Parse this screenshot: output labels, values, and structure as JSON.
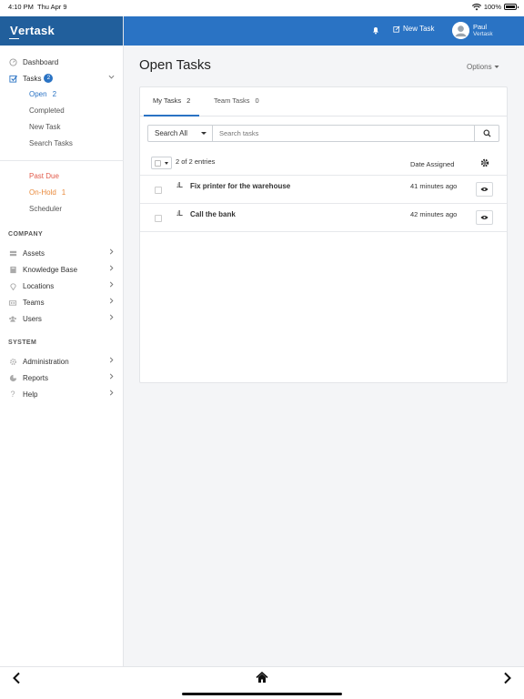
{
  "status_bar": {
    "time": "4:10 PM",
    "date": "Thu Apr 9",
    "battery": "100%"
  },
  "brand": {
    "logo_letter": "V",
    "name_rest": "ertask"
  },
  "topbar": {
    "new_task_label": "New Task",
    "user_name": "Paul",
    "user_org": "Vertask"
  },
  "sidebar": {
    "dashboard": "Dashboard",
    "tasks": {
      "label": "Tasks",
      "badge": "2"
    },
    "task_subitems": {
      "open": {
        "label": "Open",
        "count": "2"
      },
      "completed": "Completed",
      "new_task": "New Task",
      "search_tasks": "Search Tasks"
    },
    "status_items": {
      "past_due": "Past Due",
      "on_hold": {
        "label": "On-Hold",
        "count": "1"
      },
      "scheduler": "Scheduler"
    },
    "company_section": "COMPANY",
    "company_items": [
      "Assets",
      "Knowledge Base",
      "Locations",
      "Teams",
      "Users"
    ],
    "system_section": "SYSTEM",
    "system_items": [
      "Administration",
      "Reports",
      "Help"
    ]
  },
  "main": {
    "title": "Open Tasks",
    "options_label": "Options",
    "tabs": [
      {
        "label": "My Tasks",
        "count": "2"
      },
      {
        "label": "Team Tasks",
        "count": "0"
      }
    ],
    "filter": {
      "selected": "Search All",
      "search_placeholder": "Search tasks"
    },
    "list": {
      "entries_text": "2 of 2 entries",
      "date_header": "Date Assigned",
      "rows": [
        {
          "title": "Fix printer for the warehouse",
          "assigned": "41 minutes ago"
        },
        {
          "title": "Call the bank",
          "assigned": "42 minutes ago"
        }
      ]
    }
  },
  "colors": {
    "brand_dark": "#215f9c",
    "brand": "#2a73c4",
    "past_due": "#e25b4b",
    "on_hold": "#e98a3c"
  }
}
